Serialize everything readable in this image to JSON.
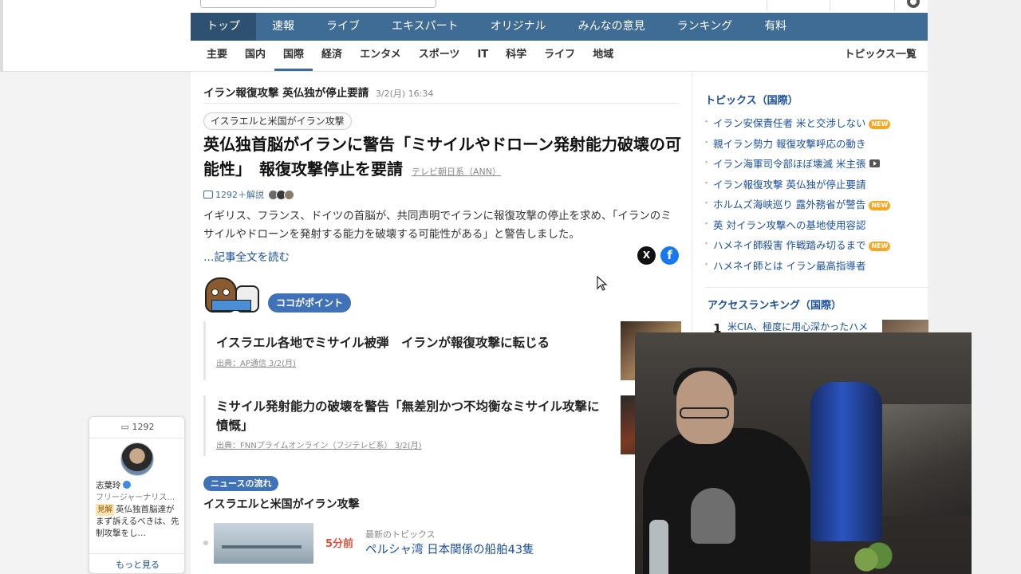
{
  "nav_main": [
    "トップ",
    "速報",
    "ライブ",
    "エキスパート",
    "オリジナル",
    "みんなの意見",
    "ランキング",
    "有料"
  ],
  "nav_main_active": 0,
  "nav_sub": [
    "主要",
    "国内",
    "国際",
    "経済",
    "エンタメ",
    "スポーツ",
    "IT",
    "科学",
    "ライフ",
    "地域"
  ],
  "nav_sub_active": 2,
  "nav_sub_all": "トピックス一覧",
  "article": {
    "header_title": "イラン報復攻撃 英仏独が停止要請",
    "header_date": "3/2(月) 16:34",
    "tag": "イスラエルと米国がイラン攻撃",
    "headline": "英仏独首脳がイランに警告「ミサイルやドローン発射能力破壊の可能性」　報復攻撃停止を要請",
    "source": "テレビ朝日系（ANN）",
    "comments": "1292＋解説",
    "summary": "イギリス、フランス、ドイツの首脳が、共同声明でイランに報復攻撃の停止を求め、「イランのミサイルやドローンを発射する能力を破壊する可能性がある」と警告しました。",
    "read_more": "…記事全文を読む",
    "share_x": "X",
    "share_fb": "f"
  },
  "point_badge": "ココがポイント",
  "related": [
    {
      "title": "イスラエル各地でミサイル被弾　イランが報復攻撃に転じる",
      "source": "出典：AP通信 3/2(月)"
    },
    {
      "title": "ミサイル発射能力の破壊を警告「無差別かつ不均衡なミサイル攻撃に憤慨」",
      "source": "出典：FNNプライムオンライン（フジテレビ系） 3/2(月)"
    }
  ],
  "flow": {
    "badge": "ニュースの流れ",
    "title": "イスラエルと米国がイラン攻撃",
    "item": {
      "time": "5分前",
      "label": "最新のトピックス",
      "headline": "ペルシャ湾 日本関係の船舶43隻"
    }
  },
  "sidebar": {
    "topics_title": "トピックス（国際）",
    "topics": [
      {
        "text": "イラン安保責任者 米と交渉しない",
        "badge": "NEW"
      },
      {
        "text": "親イラン勢力 報復攻撃呼応の動き",
        "badge": ""
      },
      {
        "text": "イラン海軍司令部ほぼ壊滅 米主張",
        "badge": "video"
      },
      {
        "text": "イラン報復攻撃 英仏独が停止要請",
        "badge": ""
      },
      {
        "text": "ホルムズ海峡巡り 露外務省が警告",
        "badge": "NEW"
      },
      {
        "text": "英 対イラン攻撃への基地使用容認",
        "badge": ""
      },
      {
        "text": "ハメネイ師殺害 作戦踏み切るまで",
        "badge": "NEW"
      },
      {
        "text": "ハメネイ師とは イラン最高指導者",
        "badge": ""
      }
    ],
    "ranking_title": "アクセスランキング（国際）",
    "ranking_first": {
      "num": "1",
      "text": "米CIA、極度に用心深かったハメ"
    }
  },
  "float_card": {
    "count": "1292",
    "name": "志葉玲",
    "role": "フリージャーナリス…",
    "tag": "見解",
    "body": "英仏独首脳達がまず訴えるべきは、先制攻撃をし…",
    "more": "もっと見る"
  },
  "colors": {
    "nav_bg": "#3f6c94",
    "link": "#1a4f9c",
    "new_badge": "#f5a623",
    "accent_badge": "#3f72b8"
  }
}
